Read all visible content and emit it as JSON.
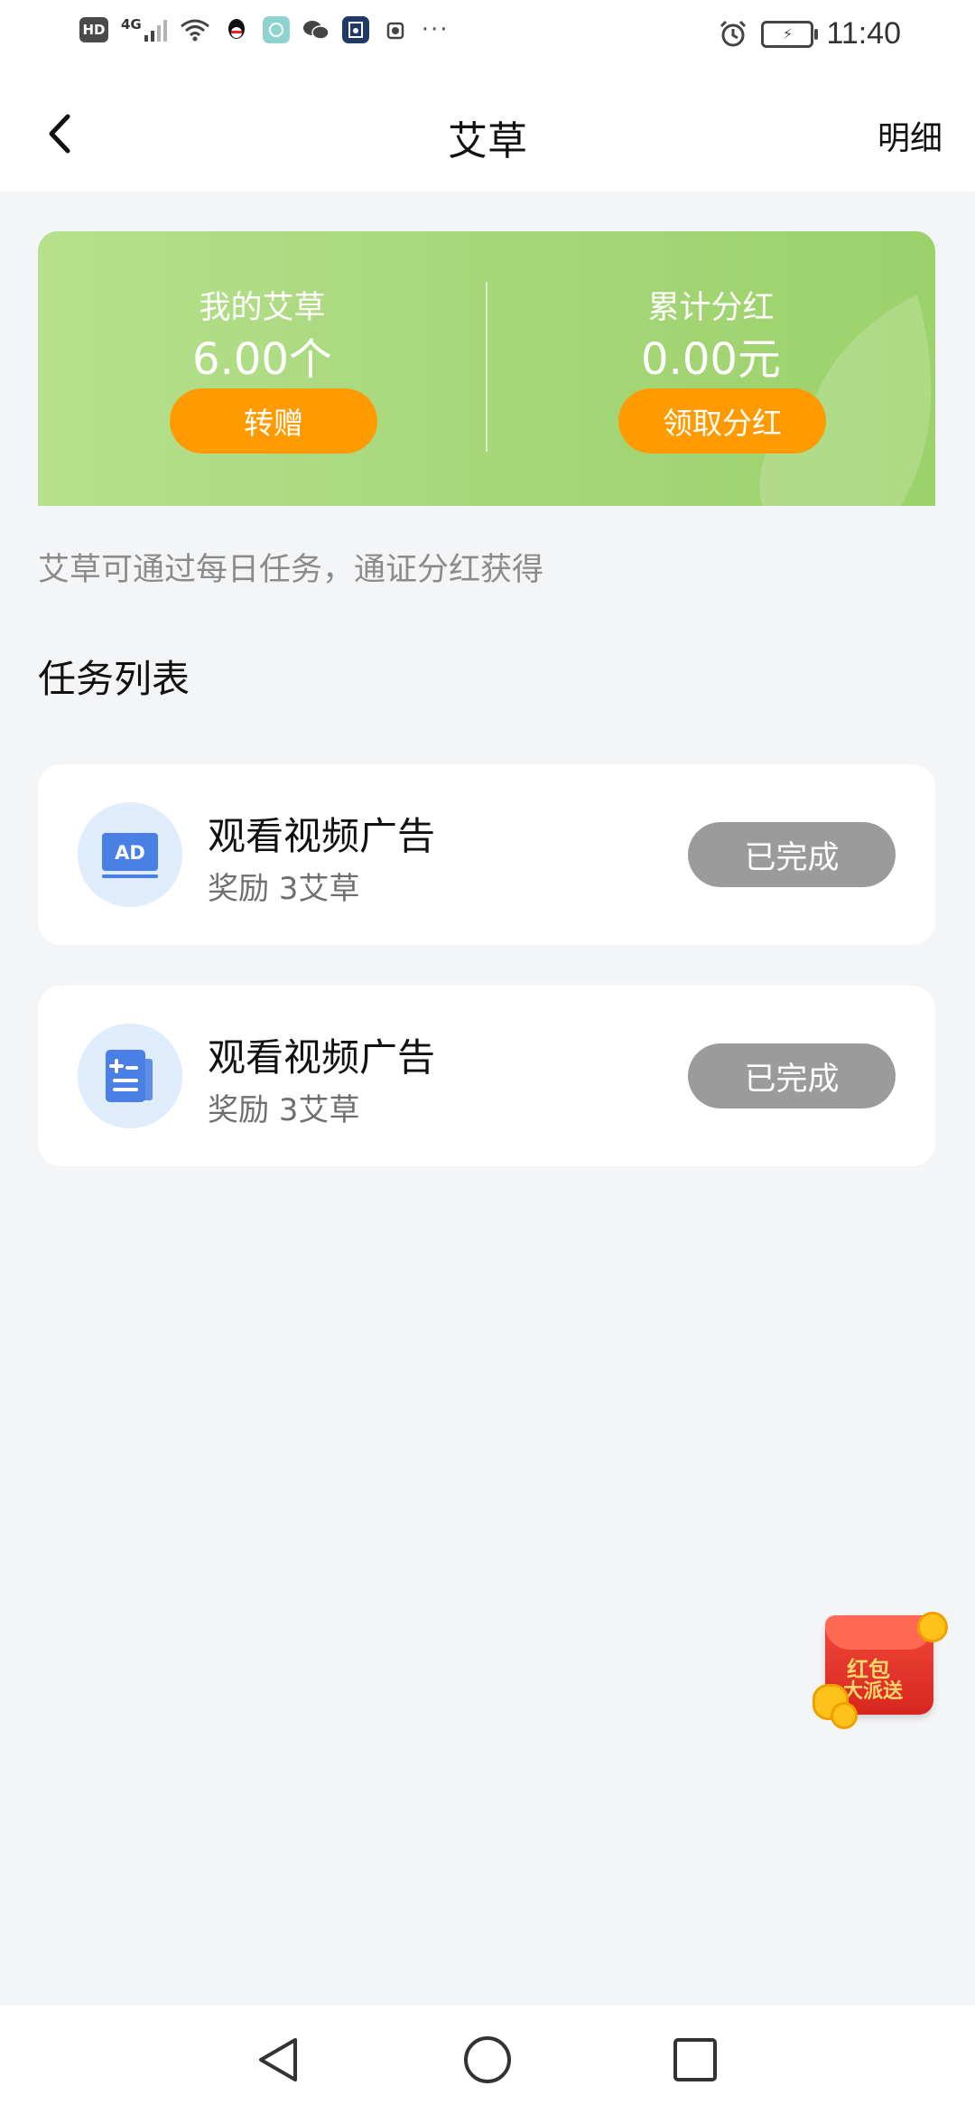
{
  "status_bar": {
    "hd_label": "HD",
    "network_label": "4G",
    "time": "11:40",
    "battery_symbol": "⚡",
    "overflow": "···"
  },
  "header": {
    "title": "艾草",
    "detail_label": "明细"
  },
  "banner": {
    "left": {
      "label": "我的艾草",
      "value": "6.00个",
      "button": "转赠"
    },
    "right": {
      "label": "累计分红",
      "value": "0.00元",
      "button": "领取分红"
    }
  },
  "hint_text": "艾草可通过每日任务，通证分红获得",
  "section_title": "任务列表",
  "tasks": [
    {
      "title": "观看视频广告",
      "reward": "奖励 3艾草",
      "status": "已完成",
      "icon": "ad-icon",
      "icon_text": "AD"
    },
    {
      "title": "观看视频广告",
      "reward": "奖励 3艾草",
      "status": "已完成",
      "icon": "document-add-icon"
    }
  ],
  "red_packet": {
    "line1": "红包",
    "line2": "大派送"
  },
  "colors": {
    "accent_orange": "#ff9a00",
    "banner_green": "#a6d678",
    "completed_gray": "#9b9b9b",
    "icon_blue": "#4a7fe5"
  }
}
